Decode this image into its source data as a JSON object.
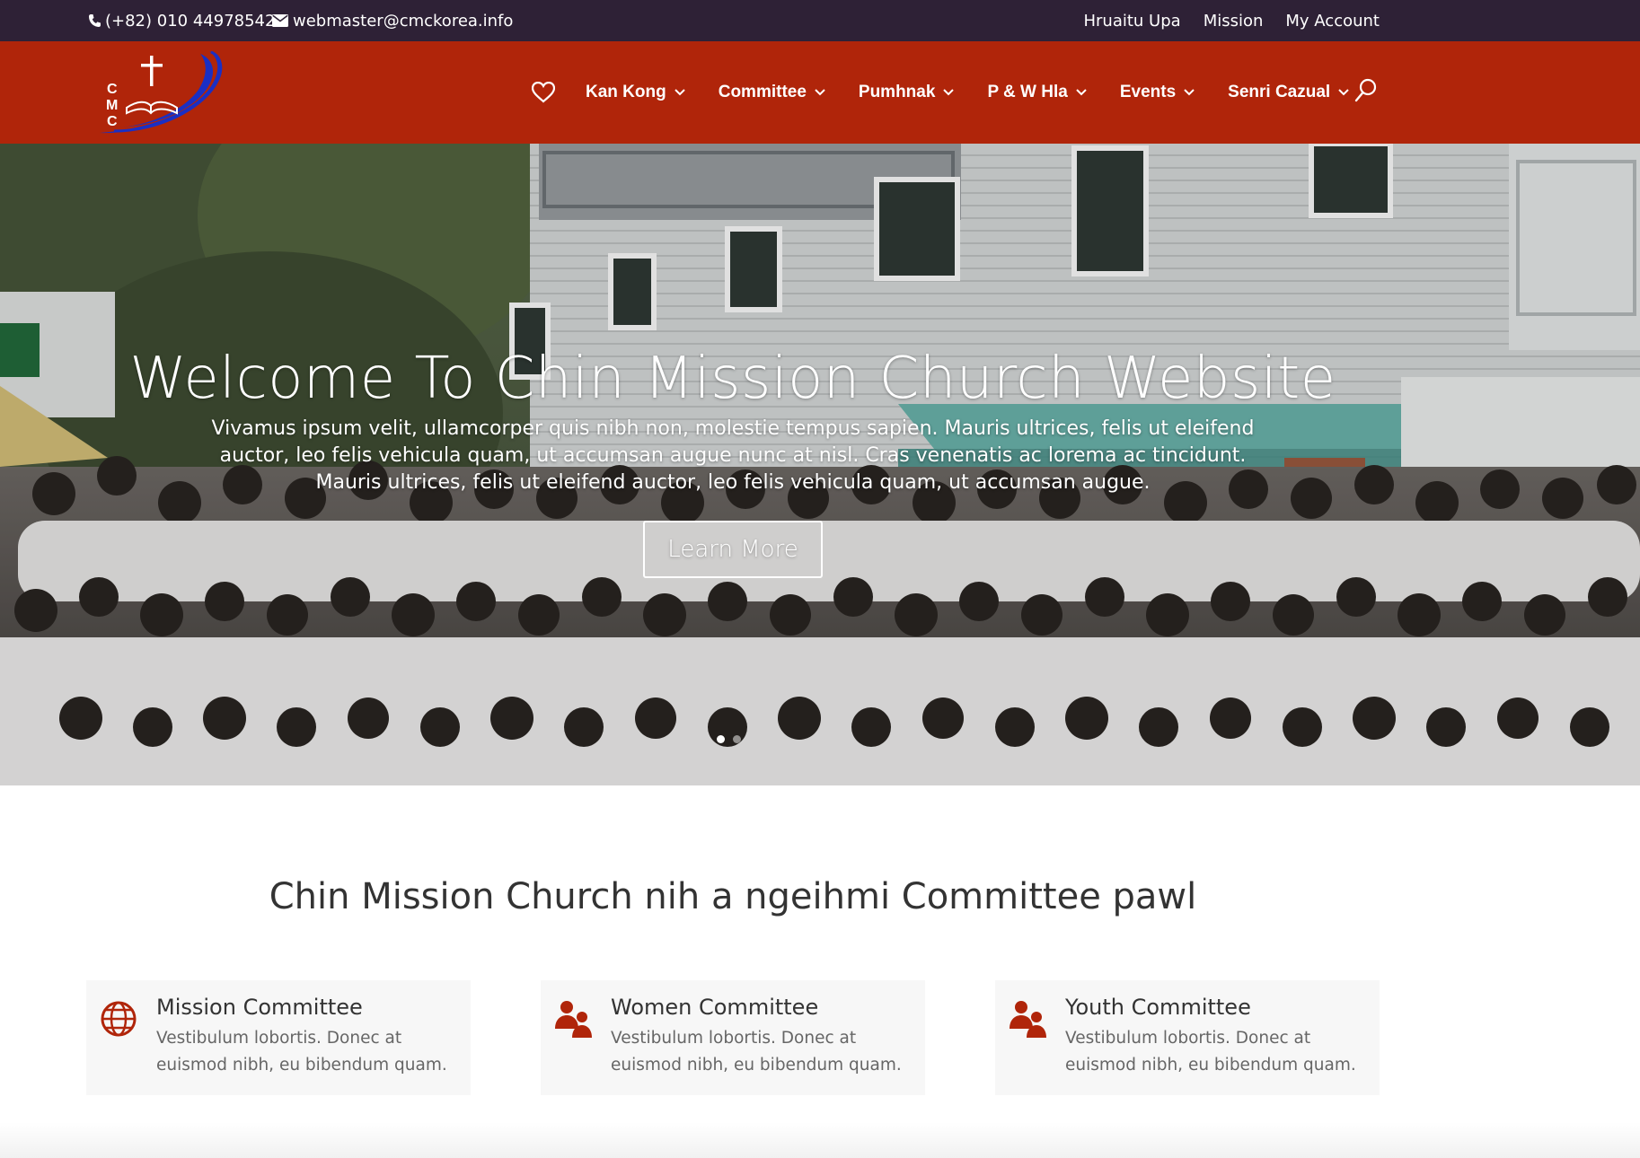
{
  "topbar": {
    "phone": "(+82) 010 44978542",
    "email": "webmaster@cmckorea.info",
    "links": [
      "Hruaitu Upa",
      "Mission",
      "My Account"
    ]
  },
  "header": {
    "logo_text": "CMC",
    "nav": [
      {
        "label": "Kan Kong"
      },
      {
        "label": "Committee"
      },
      {
        "label": "Pumhnak"
      },
      {
        "label": "P & W Hla"
      },
      {
        "label": "Events"
      },
      {
        "label": "Senri Cazual"
      }
    ],
    "icons": [
      "heart-icon",
      "search-icon",
      "chevron-down-icon"
    ]
  },
  "hero": {
    "title": "Welcome To Chin Mission Church Website",
    "description": "Vivamus ipsum velit, ullamcorper quis nibh non, molestie tempus sapien. Mauris ultrices, felis ut eleifend auctor, leo felis vehicula quam, ut accumsan augue nunc at nisl. Cras venenatis ac lorema ac tincidunt. Mauris ultrices, felis ut eleifend auctor, leo felis vehicula quam, ut accumsan augue.",
    "button": "Learn More"
  },
  "section": {
    "title": "Chin Mission Church nih a ngeihmi Committee pawl",
    "cards": [
      {
        "title": "Mission Committee",
        "description": "Vestibulum lobortis. Donec at euismod nibh, eu bibendum quam.",
        "icon": "globe-icon"
      },
      {
        "title": "Women Committee",
        "description": "Vestibulum lobortis. Donec at euismod nibh, eu bibendum quam.",
        "icon": "people-icon"
      },
      {
        "title": "Youth Committee",
        "description": "Vestibulum lobortis. Donec at euismod nibh, eu bibendum quam.",
        "icon": "people-icon"
      }
    ]
  },
  "colors": {
    "topbar": "#2e2136",
    "header": "#b0250a",
    "accent": "#b0250a",
    "logo_blue": "#1a2fc4"
  }
}
